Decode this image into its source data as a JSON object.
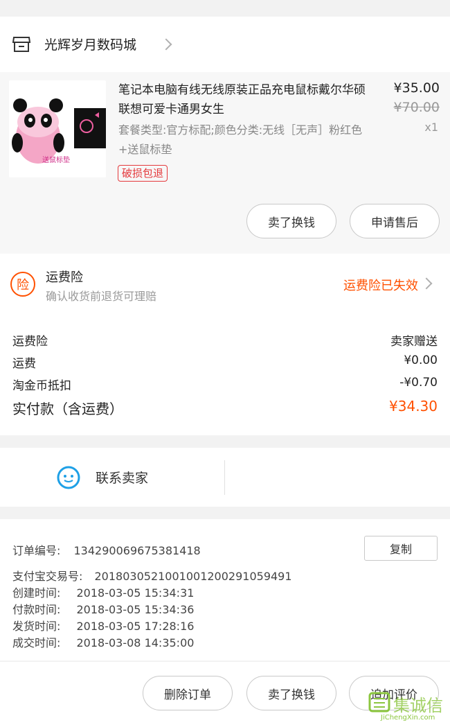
{
  "shop": {
    "name": "光辉岁月数码城",
    "icon": "shop-icon"
  },
  "product": {
    "title": "笔记本电脑有线无线原装正品充电鼠标戴尔华硕联想可爱卡通男女生",
    "sku": "套餐类型:官方标配;颜色分类:无线［无声］粉红色+送鼠标垫",
    "badge": "破损包退",
    "price": "¥35.00",
    "original_price": "¥70.00",
    "quantity": "x1",
    "thumbnail_caption": "送鼠标垫",
    "buttons": {
      "exchange": "卖了换钱",
      "after_sale": "申请售后"
    }
  },
  "insurance": {
    "icon_text": "险",
    "title": "运费险",
    "subtitle": "确认收货前退货可理赔",
    "status": "运费险已失效",
    "accent_color": "#ff5000"
  },
  "fees": [
    {
      "label": "运费险",
      "value": "卖家赠送"
    },
    {
      "label": "运费",
      "value": "¥0.00"
    },
    {
      "label": "淘金币抵扣",
      "value": "-¥0.70"
    },
    {
      "label": "实付款（含运费）",
      "value": "¥34.30"
    }
  ],
  "contact": {
    "label": "联系卖家",
    "icon": "chat-icon"
  },
  "order_info": {
    "order_no_label": "订单编号:",
    "order_no": "134290069675381418",
    "copy_label": "复制",
    "alipay_label": "支付宝交易号:",
    "alipay_no": "2018030521001001200291059491",
    "created_label": "创建时间:",
    "created": "2018-03-05 15:34:31",
    "paid_label": "付款时间:",
    "paid": "2018-03-05 15:34:36",
    "shipped_label": "发货时间:",
    "shipped": "2018-03-05 17:28:16",
    "done_label": "成交时间:",
    "done": "2018-03-08 14:35:00"
  },
  "actions": {
    "delete": "删除订单",
    "exchange": "卖了换钱",
    "review": "追加评价"
  },
  "watermark": {
    "text": "集诚信",
    "url_text": "JiChengXin.com"
  }
}
